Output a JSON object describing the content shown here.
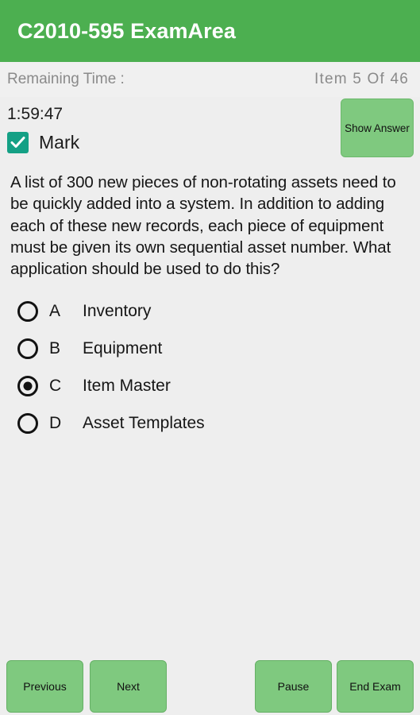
{
  "app": {
    "title": "C2010-595 ExamArea"
  },
  "status_bar": {
    "remaining_time_label": "Remaining Time :",
    "item_counter": "Item 5 Of 46",
    "timer_value": "1:59:47",
    "mark_label": "Mark",
    "mark_checked": true,
    "show_answer_label": "Show Answer"
  },
  "question": {
    "text": "A list of 300 new pieces of non-rotating assets need to be quickly added into a system. In addition to adding each of these new records, each piece of equipment must be given its own sequential asset number. What application should be used to do this?",
    "options": [
      {
        "letter": "A",
        "text": "Inventory",
        "selected": false
      },
      {
        "letter": "B",
        "text": "Equipment",
        "selected": false
      },
      {
        "letter": "C",
        "text": "Item Master",
        "selected": true
      },
      {
        "letter": "D",
        "text": "Asset Templates",
        "selected": false
      }
    ]
  },
  "bottom_bar": {
    "previous_label": "Previous",
    "next_label": "Next",
    "pause_label": "Pause",
    "end_exam_label": "End Exam"
  },
  "colors": {
    "header_green": "#4caf50",
    "button_green": "#7fc97f",
    "checkbox_teal": "#14a085",
    "page_background": "#eeeeee",
    "info_background": "#f0f0f0",
    "muted_text": "#8a8a8a",
    "body_text": "#161616"
  }
}
